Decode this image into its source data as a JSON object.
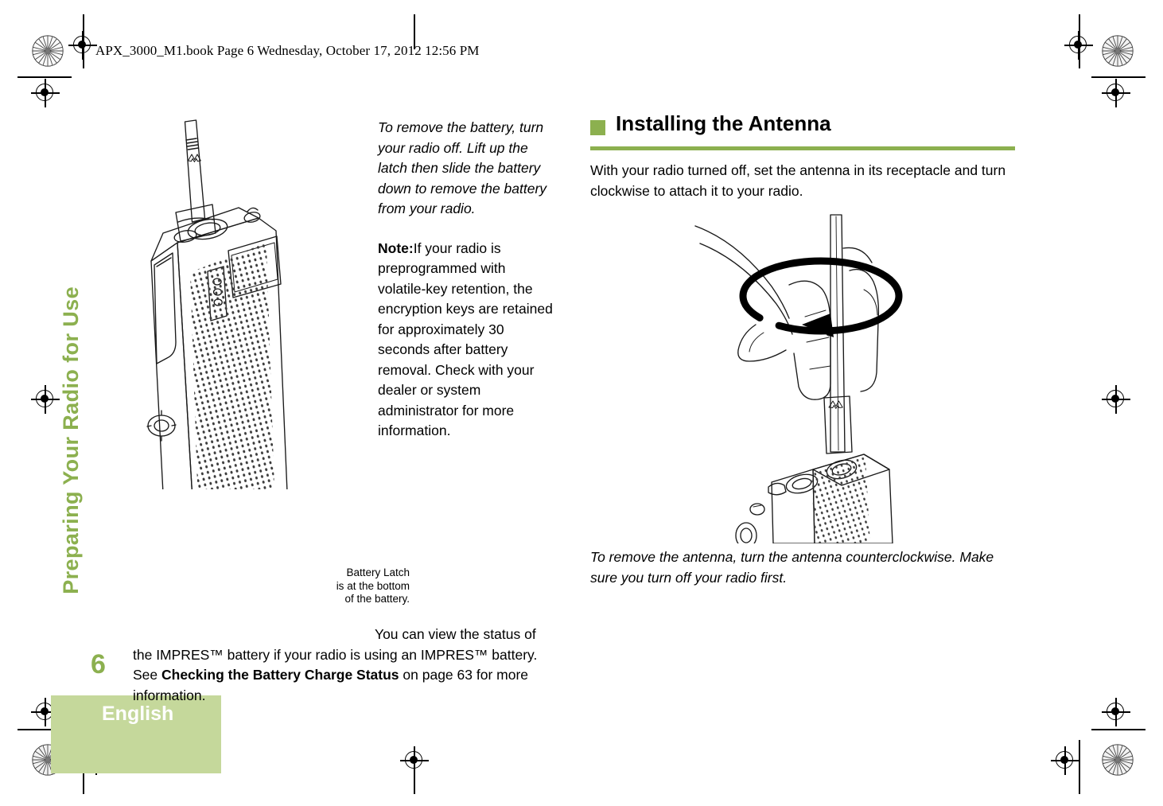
{
  "header": {
    "filename_line": "APX_3000_M1.book  Page 6  Wednesday, October 17, 2012  12:56 PM"
  },
  "sidebar": {
    "running_head": "Preparing Your Radio for Use",
    "page_number": "6",
    "language": "English",
    "accent_color": "#8CB04F",
    "band_color": "#C5D89B"
  },
  "left_column": {
    "intro_italic": "To remove the battery, turn your radio off. Lift up the latch then slide the battery down to remove the battery from your radio.",
    "note_label": "Note:",
    "note_text": "If your radio is preprogrammed with volatile-key retention, the encryption keys are retained for approximately 30 seconds after battery removal. Check with your dealer or system administrator for more information.",
    "callout": {
      "line1": "Battery Latch",
      "line2": "is at the bottom",
      "line3": "of the battery."
    },
    "tail_paragraph": {
      "part1": "You can view the status of the IMPRES™ battery if your radio is using an IMPRES™ battery. See ",
      "bold_ref": "Checking the Battery Charge Status",
      "part2": " on page 63 for more information."
    },
    "figure_name": "radio-with-battery-latch-illustration"
  },
  "right_column": {
    "heading": "Installing the Antenna",
    "intro": "With your radio turned off, set the antenna in its receptacle and turn clockwise to attach it to your radio.",
    "tail_italic": "To remove the antenna, turn the antenna counterclockwise. Make sure you turn off your radio first.",
    "figure_name": "hand-turning-antenna-clockwise-illustration"
  }
}
